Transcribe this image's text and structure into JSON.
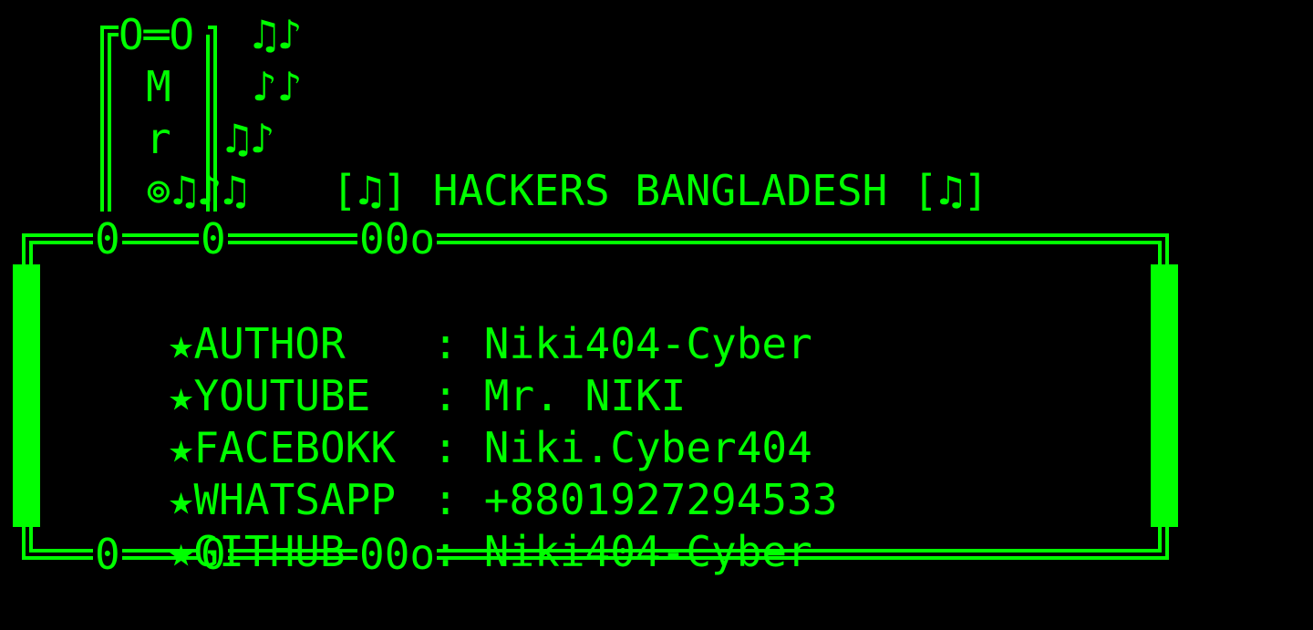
{
  "theme": {
    "foreground": "#00ff00",
    "background": "#000000"
  },
  "logo": {
    "top_eyes": "O═O",
    "letter_m": "M",
    "letter_r": "r",
    "base_glyph": "⊚",
    "notes_line1": "♫♪",
    "notes_line2": "♪♪",
    "notes_line3": "♫♪",
    "notes_line4": "♫♪♫"
  },
  "banner": {
    "title": "[♫] HACKERS BANGLADESH [♫]"
  },
  "box": {
    "top_marks": {
      "left": "0",
      "mid": "0",
      "right": "00o"
    },
    "bottom_marks": {
      "left": "0",
      "mid": "0",
      "right": "00o"
    }
  },
  "info": {
    "rows": [
      {
        "icon": "★",
        "label": "AUTHOR",
        "sep": ":",
        "value": "Niki404-Cyber"
      },
      {
        "icon": "★",
        "label": "YOUTUBE",
        "sep": ":",
        "value": "Mr. NIKI"
      },
      {
        "icon": "★",
        "label": "FACEBOKK",
        "sep": ":",
        "value": "Niki.Cyber404"
      },
      {
        "icon": "★",
        "label": "WHATSAPP",
        "sep": ":",
        "value": "+8801927294533"
      },
      {
        "icon": "★",
        "label": "GITHUB",
        "sep": ":",
        "value": "Niki404-Cyber"
      }
    ]
  }
}
